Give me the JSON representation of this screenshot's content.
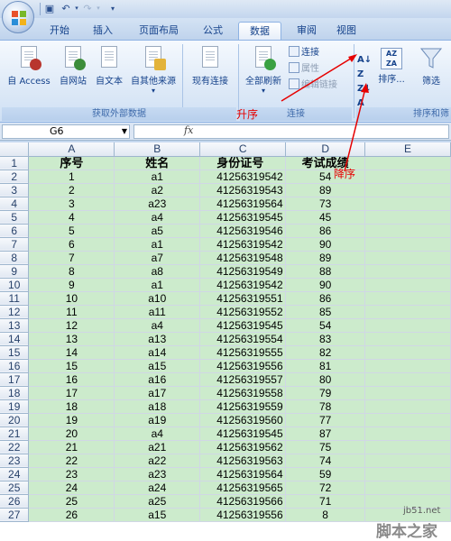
{
  "ribbon_tabs": [
    "开始",
    "插入",
    "页面布局",
    "公式",
    "数据",
    "审阅",
    "视图"
  ],
  "active_tab": "数据",
  "groups": {
    "external": {
      "label": "获取外部数据",
      "buttons": [
        "自 Access",
        "自网站",
        "自文本",
        "自其他来源",
        "现有连接"
      ]
    },
    "connections": {
      "label": "连接",
      "refresh": "全部刷新",
      "small": [
        "连接",
        "属性",
        "编辑链接"
      ]
    },
    "sort": {
      "label": "排序和筛",
      "sort_button": "排序...",
      "filter_button": "筛选"
    }
  },
  "namebox": "G6",
  "fx": "fx",
  "columns": [
    "A",
    "B",
    "C",
    "D",
    "E"
  ],
  "header_row": [
    "序号",
    "姓名",
    "身份证号",
    "考试成绩"
  ],
  "rows": [
    [
      "1",
      "a1",
      "41256319542",
      "54"
    ],
    [
      "2",
      "a2",
      "41256319543",
      "89"
    ],
    [
      "3",
      "a23",
      "41256319564",
      "73"
    ],
    [
      "4",
      "a4",
      "41256319545",
      "45"
    ],
    [
      "5",
      "a5",
      "41256319546",
      "86"
    ],
    [
      "6",
      "a1",
      "41256319542",
      "90"
    ],
    [
      "7",
      "a7",
      "41256319548",
      "89"
    ],
    [
      "8",
      "a8",
      "41256319549",
      "88"
    ],
    [
      "9",
      "a1",
      "41256319542",
      "90"
    ],
    [
      "10",
      "a10",
      "41256319551",
      "86"
    ],
    [
      "11",
      "a11",
      "41256319552",
      "85"
    ],
    [
      "12",
      "a4",
      "41256319545",
      "54"
    ],
    [
      "13",
      "a13",
      "41256319554",
      "83"
    ],
    [
      "14",
      "a14",
      "41256319555",
      "82"
    ],
    [
      "15",
      "a15",
      "41256319556",
      "81"
    ],
    [
      "16",
      "a16",
      "41256319557",
      "80"
    ],
    [
      "17",
      "a17",
      "41256319558",
      "79"
    ],
    [
      "18",
      "a18",
      "41256319559",
      "78"
    ],
    [
      "19",
      "a19",
      "41256319560",
      "77"
    ],
    [
      "20",
      "a4",
      "41256319545",
      "87"
    ],
    [
      "21",
      "a21",
      "41256319562",
      "75"
    ],
    [
      "22",
      "a22",
      "41256319563",
      "74"
    ],
    [
      "23",
      "a23",
      "41256319564",
      "59"
    ],
    [
      "24",
      "a24",
      "41256319565",
      "72"
    ],
    [
      "25",
      "a25",
      "41256319566",
      "71"
    ],
    [
      "26",
      "a15",
      "41256319556",
      "8"
    ]
  ],
  "annotations": {
    "ascending": "升序",
    "descending": "降序"
  },
  "watermark": {
    "site": "jb51.net",
    "brand": "脚本之家"
  },
  "colors": {
    "cell_fill": "#ccebcc",
    "annotation": "#e60000",
    "ribbon_text": "#15428b"
  }
}
